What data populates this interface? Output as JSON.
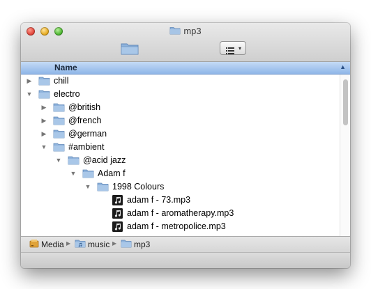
{
  "window": {
    "title": "mp3"
  },
  "toolbar": {
    "view_menu_caret": "▾"
  },
  "list": {
    "column_header": "Name",
    "rows": [
      {
        "label": "chill",
        "icon": "folder",
        "expanded": false
      },
      {
        "label": "electro",
        "icon": "folder",
        "expanded": true
      },
      {
        "label": "@british",
        "icon": "folder",
        "expanded": false
      },
      {
        "label": "@french",
        "icon": "folder",
        "expanded": false
      },
      {
        "label": "@german",
        "icon": "folder",
        "expanded": false
      },
      {
        "label": "#ambient",
        "icon": "folder",
        "expanded": true
      },
      {
        "label": "@acid jazz",
        "icon": "folder",
        "expanded": true
      },
      {
        "label": "Adam f",
        "icon": "folder",
        "expanded": true
      },
      {
        "label": "1998 Colours",
        "icon": "folder",
        "expanded": true
      },
      {
        "label": "adam f - 73.mp3",
        "icon": "mp3-file"
      },
      {
        "label": "adam f - aromatherapy.mp3",
        "icon": "mp3-file"
      },
      {
        "label": "adam f - metropolice.mp3",
        "icon": "mp3-file"
      }
    ]
  },
  "pathbar": {
    "items": [
      {
        "label": "Media",
        "icon": "drive"
      },
      {
        "label": "music",
        "icon": "music-folder"
      },
      {
        "label": "mp3",
        "icon": "folder"
      }
    ]
  },
  "colors": {
    "folder": "#8fb3dc",
    "header": "#a9c6ee",
    "accent": "#6f95c9"
  }
}
